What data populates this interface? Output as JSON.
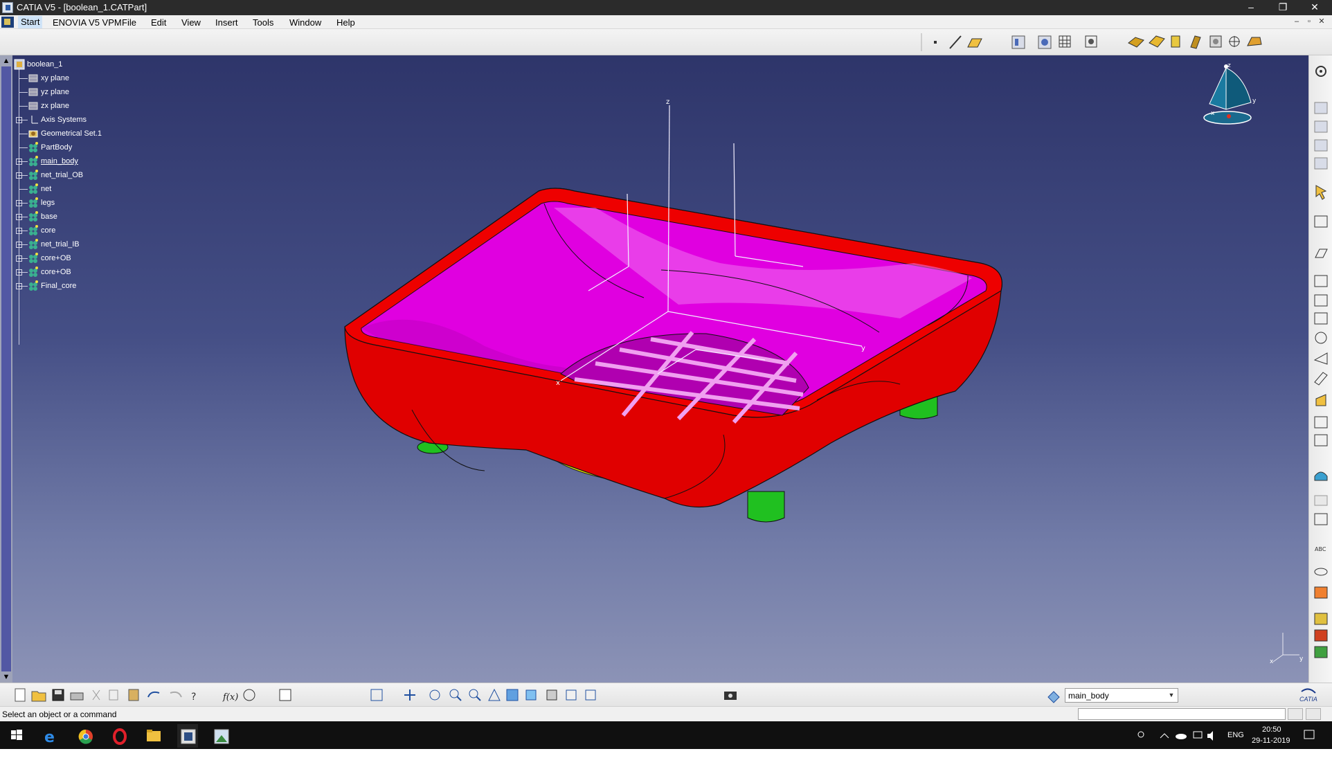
{
  "window": {
    "title": "CATIA V5 - [boolean_1.CATPart]",
    "minimize": "–",
    "restore": "❐",
    "close": "✕"
  },
  "menu": {
    "items": [
      "Start",
      "ENOVIA V5 VPM",
      "File",
      "Edit",
      "View",
      "Insert",
      "Tools",
      "Window",
      "Help"
    ],
    "mdi_buttons": [
      "–",
      "▫",
      "✕"
    ]
  },
  "tree": {
    "root": "boolean_1",
    "items": [
      {
        "label": "xy plane",
        "icon": "plane-icon",
        "underline": false,
        "expandable": false
      },
      {
        "label": "yz plane",
        "icon": "plane-icon",
        "underline": false,
        "expandable": false
      },
      {
        "label": "zx plane",
        "icon": "plane-icon",
        "underline": false,
        "expandable": false
      },
      {
        "label": "Axis Systems",
        "icon": "axis-system-icon",
        "underline": false,
        "expandable": true
      },
      {
        "label": "Geometrical Set.1",
        "icon": "geometrical-set-icon",
        "underline": false,
        "expandable": false
      },
      {
        "label": "PartBody",
        "icon": "body-icon",
        "underline": false,
        "expandable": false
      },
      {
        "label": "main_body",
        "icon": "body-icon",
        "underline": true,
        "expandable": true
      },
      {
        "label": "net_trial_OB",
        "icon": "body-icon",
        "underline": false,
        "expandable": true
      },
      {
        "label": "net",
        "icon": "body-icon",
        "underline": false,
        "expandable": false
      },
      {
        "label": "legs",
        "icon": "body-icon",
        "underline": false,
        "expandable": true
      },
      {
        "label": "base",
        "icon": "body-icon",
        "underline": false,
        "expandable": true
      },
      {
        "label": "core",
        "icon": "body-icon",
        "underline": false,
        "expandable": true
      },
      {
        "label": "net_trial_IB",
        "icon": "body-icon",
        "underline": false,
        "expandable": true
      },
      {
        "label": "core+OB",
        "icon": "body-icon",
        "underline": false,
        "expandable": true
      },
      {
        "label": "core+OB",
        "icon": "body-icon",
        "underline": false,
        "expandable": true
      },
      {
        "label": "Final_core",
        "icon": "body-icon",
        "underline": false,
        "expandable": true
      }
    ]
  },
  "viewport": {
    "axis_labels": {
      "z": "z",
      "y": "y",
      "x": "x"
    },
    "compass_labels": {
      "z": "z",
      "x": "x",
      "y": "y"
    },
    "colors": {
      "rim": "#e80000",
      "interior": "#d800d8",
      "legs": "#18c018",
      "base": "#e0e000",
      "background_top": "#2e356a",
      "background_bottom": "#8c93b6"
    }
  },
  "bottom_toolbar": {
    "current_body": "main_body"
  },
  "status": {
    "message": "Select an object or a command"
  },
  "taskbar": {
    "language": "ENG",
    "time": "20:50",
    "date": "29-11-2019"
  },
  "brand": {
    "logo_text": "CATIA"
  }
}
